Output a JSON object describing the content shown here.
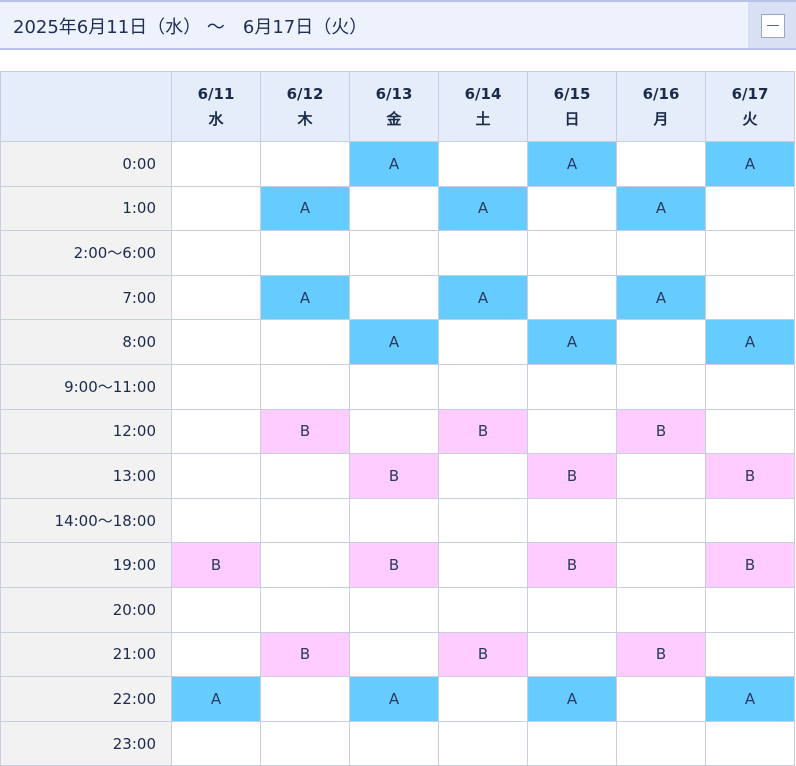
{
  "header": {
    "title": "2025年6月11日（水） ～　6月17日（火）",
    "collapse_icon": "minus-icon"
  },
  "days": [
    {
      "date": "6/11",
      "weekday": "水"
    },
    {
      "date": "6/12",
      "weekday": "木"
    },
    {
      "date": "6/13",
      "weekday": "金"
    },
    {
      "date": "6/14",
      "weekday": "土"
    },
    {
      "date": "6/15",
      "weekday": "日"
    },
    {
      "date": "6/16",
      "weekday": "月"
    },
    {
      "date": "6/17",
      "weekday": "火"
    }
  ],
  "rows": [
    {
      "time": "0:00",
      "slots": [
        "",
        "",
        "A",
        "",
        "A",
        "",
        "A"
      ]
    },
    {
      "time": "1:00",
      "slots": [
        "",
        "A",
        "",
        "A",
        "",
        "A",
        ""
      ]
    },
    {
      "time": "2:00～6:00",
      "slots": [
        "",
        "",
        "",
        "",
        "",
        "",
        ""
      ]
    },
    {
      "time": "7:00",
      "slots": [
        "",
        "A",
        "",
        "A",
        "",
        "A",
        ""
      ]
    },
    {
      "time": "8:00",
      "slots": [
        "",
        "",
        "A",
        "",
        "A",
        "",
        "A"
      ]
    },
    {
      "time": "9:00～11:00",
      "slots": [
        "",
        "",
        "",
        "",
        "",
        "",
        ""
      ]
    },
    {
      "time": "12:00",
      "slots": [
        "",
        "B",
        "",
        "B",
        "",
        "B",
        ""
      ]
    },
    {
      "time": "13:00",
      "slots": [
        "",
        "",
        "B",
        "",
        "B",
        "",
        "B"
      ]
    },
    {
      "time": "14:00～18:00",
      "slots": [
        "",
        "",
        "",
        "",
        "",
        "",
        ""
      ]
    },
    {
      "time": "19:00",
      "slots": [
        "B",
        "",
        "B",
        "",
        "B",
        "",
        "B"
      ]
    },
    {
      "time": "20:00",
      "slots": [
        "",
        "",
        "",
        "",
        "",
        "",
        ""
      ]
    },
    {
      "time": "21:00",
      "slots": [
        "",
        "B",
        "",
        "B",
        "",
        "B",
        ""
      ]
    },
    {
      "time": "22:00",
      "slots": [
        "A",
        "",
        "A",
        "",
        "A",
        "",
        "A"
      ]
    },
    {
      "time": "23:00",
      "slots": [
        "",
        "",
        "",
        "",
        "",
        "",
        ""
      ]
    }
  ],
  "colors": {
    "slot_A": "#66ccff",
    "slot_B": "#ffccff",
    "header_bg": "#e5ecfa",
    "time_bg": "#f2f2f2"
  }
}
